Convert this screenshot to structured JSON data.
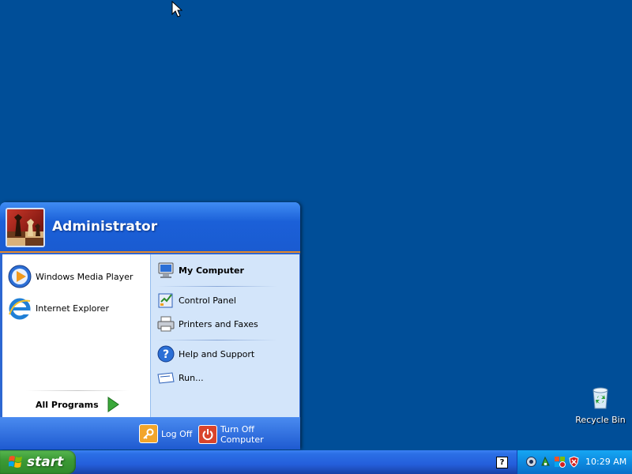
{
  "desktop": {
    "icons": [
      {
        "label": "Recycle Bin",
        "icon": "recycle-bin-icon"
      }
    ]
  },
  "start_menu": {
    "user": "Administrator",
    "pinned": [
      {
        "label": "Windows Media Player",
        "icon": "media-player-icon"
      },
      {
        "label": "Internet Explorer",
        "icon": "internet-explorer-icon"
      }
    ],
    "all_programs": "All Programs",
    "places": [
      {
        "label": "My Computer",
        "icon": "my-computer-icon",
        "bold": true
      },
      {
        "label": "Control Panel",
        "icon": "control-panel-icon"
      },
      {
        "label": "Printers and Faxes",
        "icon": "printer-icon"
      },
      {
        "label": "Help and Support",
        "icon": "help-icon"
      },
      {
        "label": "Run...",
        "icon": "run-icon"
      }
    ],
    "footer": {
      "log_off": "Log Off",
      "turn_off": "Turn Off Computer"
    }
  },
  "taskbar": {
    "start_label": "start",
    "help_glyph": "?",
    "clock": "10:29 AM"
  }
}
